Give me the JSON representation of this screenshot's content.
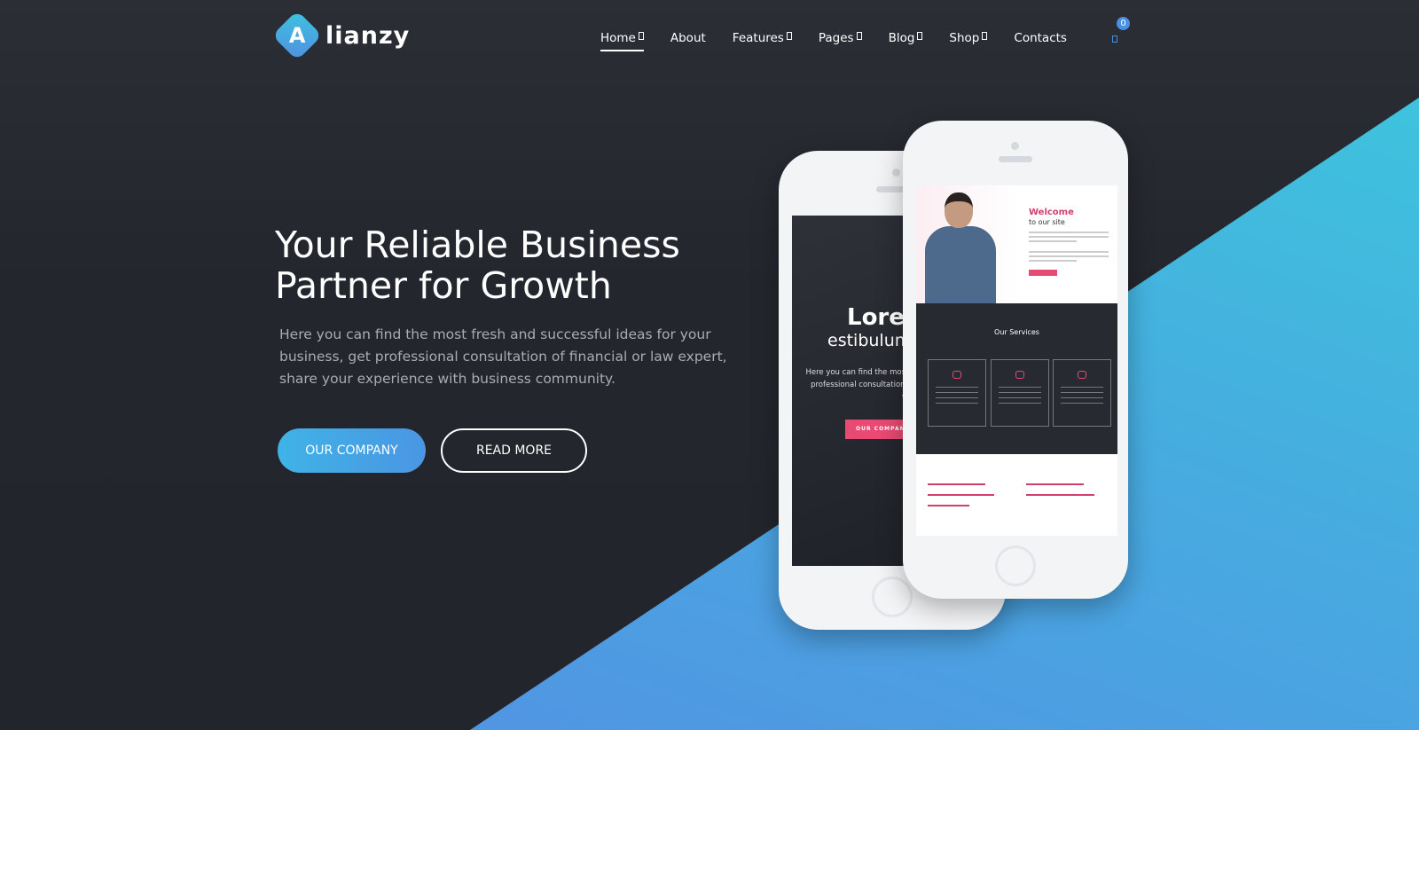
{
  "brand": {
    "logo_letter": "A",
    "name": "lianzy"
  },
  "nav": {
    "items": [
      {
        "label": "Home",
        "dropdown": true,
        "active": true
      },
      {
        "label": "About",
        "dropdown": false
      },
      {
        "label": "Features",
        "dropdown": true
      },
      {
        "label": "Pages",
        "dropdown": true
      },
      {
        "label": "Blog",
        "dropdown": true
      },
      {
        "label": "Shop",
        "dropdown": true
      },
      {
        "label": "Contacts",
        "dropdown": false
      }
    ],
    "cart_icon": "shopping-cart-icon",
    "cart_count": "0"
  },
  "hero": {
    "title": "Your Reliable Business Partner for Growth",
    "text": "Here you can find the most fresh and successful ideas for your business, get professional consultation of financial or law expert, share your experience with business community.",
    "primary_button": "OUR COMPANY",
    "secondary_button": "READ MORE"
  },
  "mockup": {
    "back_screen": {
      "title": "Lorer",
      "subtitle": "estibulum",
      "text": "Here you can find the most fres\nprofessional consultation of fir\nwith b",
      "button": "OUR COMPAN"
    },
    "front_screen": {
      "welcome": "Welcome",
      "welcome_sub": "to our site",
      "services_title": "Our Services"
    }
  },
  "colors": {
    "accent": "#4a96e3",
    "accent_cyan": "#3ec8dc",
    "pink": "#e84a73",
    "dark": "#23262d"
  }
}
